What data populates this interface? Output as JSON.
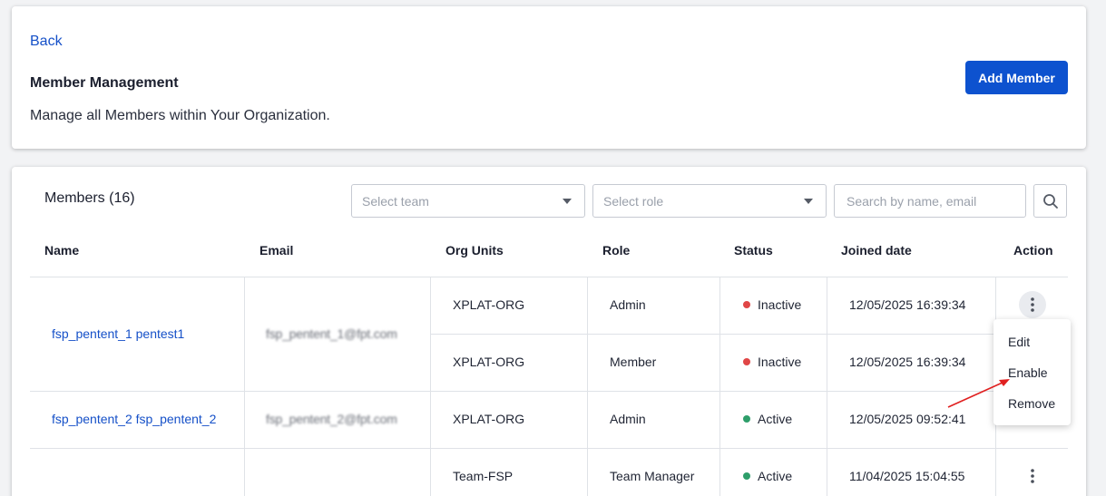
{
  "header": {
    "back_label": "Back",
    "title": "Member Management",
    "subtitle": "Manage all Members within Your Organization.",
    "add_member_label": "Add Member"
  },
  "members": {
    "count_label": "Members (16)",
    "team_placeholder": "Select team",
    "role_placeholder": "Select role",
    "search_placeholder": "Search by name, email",
    "columns": [
      "Name",
      "Email",
      "Org Units",
      "Role",
      "Status",
      "Joined date",
      "Action"
    ],
    "rows": [
      {
        "name": "fsp_pentent_1 pentest1",
        "email": "fsp_pentent_1@fpt.com",
        "units": [
          {
            "org": "XPLAT-ORG",
            "role": "Admin",
            "status": "Inactive",
            "joined": "12/05/2025 16:39:34"
          },
          {
            "org": "XPLAT-ORG",
            "role": "Member",
            "status": "Inactive",
            "joined": "12/05/2025 16:39:34"
          }
        ]
      },
      {
        "name": "fsp_pentent_2 fsp_pentent_2",
        "email": "fsp_pentent_2@fpt.com",
        "units": [
          {
            "org": "XPLAT-ORG",
            "role": "Admin",
            "status": "Active",
            "joined": "12/05/2025 09:52:41"
          }
        ]
      },
      {
        "name": "",
        "email": "",
        "units": [
          {
            "org": "Team-FSP",
            "role": "Team Manager",
            "status": "Active",
            "joined": "11/04/2025 15:04:55"
          }
        ]
      }
    ]
  },
  "action_menu": {
    "items": [
      "Edit",
      "Enable",
      "Remove"
    ]
  },
  "colors": {
    "primary": "#0d52cf",
    "link": "#1550c8",
    "status_active": "#2e9e6a",
    "status_inactive": "#e04646",
    "annotation_arrow": "#e02020"
  }
}
